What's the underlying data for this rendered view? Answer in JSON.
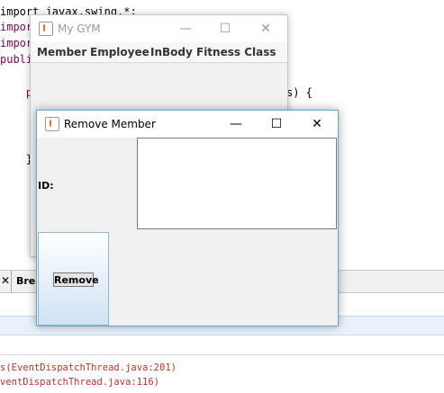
{
  "ide": {
    "code_lines": [
      "import javax.swing.*;",
      "impor",
      "impor",
      "publi",
      "    p",
      "s) {",
      "    }"
    ],
    "panel_tab_close": "✕",
    "panel_tab_label": "Brea",
    "console_lines": [
      "s(EventDispatchThread.java:201)",
      "ventDispatchThread.java:116)"
    ]
  },
  "gym_window": {
    "title": "My GYM",
    "icon": "java-cup-icon",
    "controls": {
      "minimize": "—",
      "maximize": "☐",
      "close": "✕"
    },
    "menu": [
      "Member",
      "Employee",
      "InBody",
      "Fitness Class"
    ]
  },
  "remove_window": {
    "title": "Remove Member",
    "icon": "java-cup-icon",
    "controls": {
      "minimize": "—",
      "maximize": "☐",
      "close": "✕"
    },
    "id_label": "ID:",
    "id_value": "",
    "remove_label": "Remove"
  }
}
